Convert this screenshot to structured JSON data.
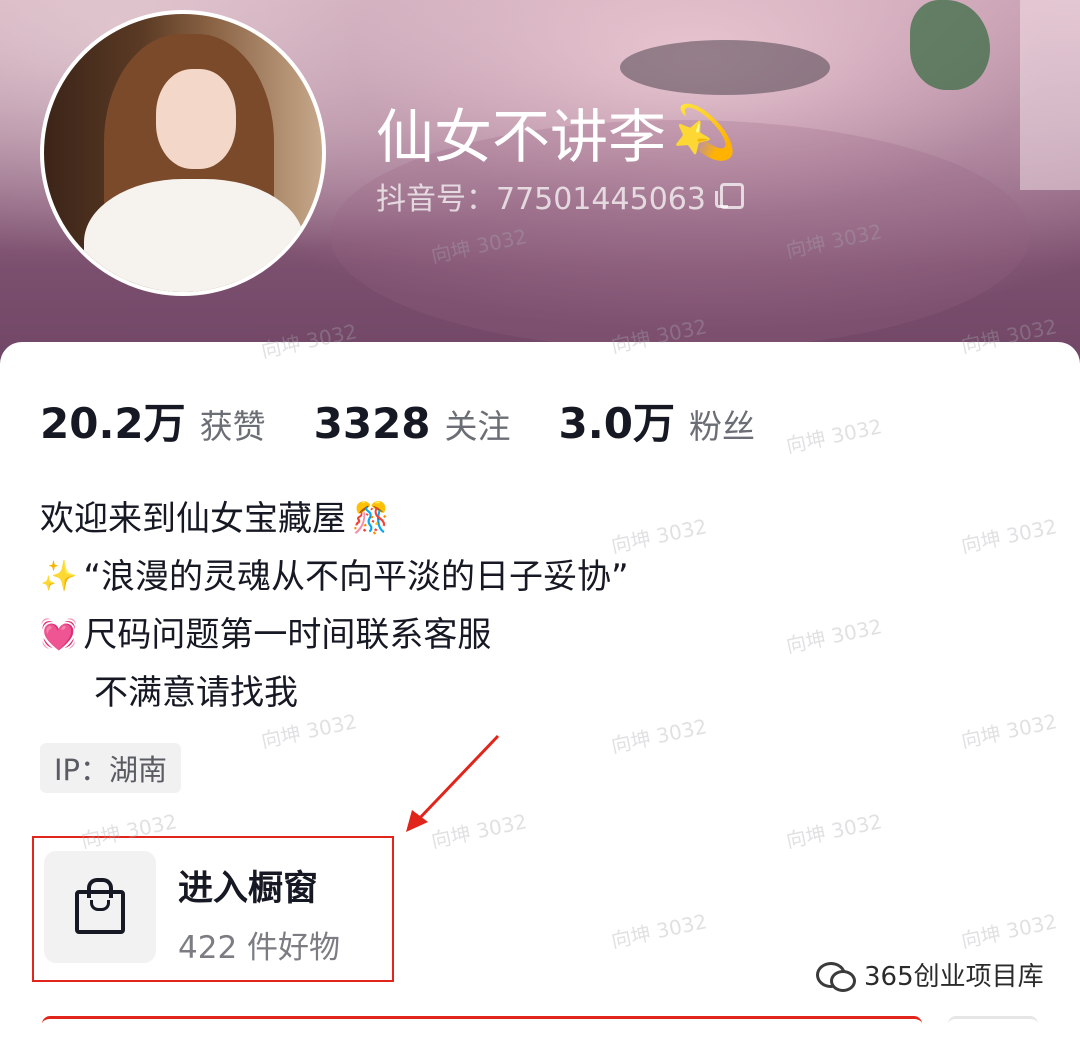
{
  "profile": {
    "nickname": "仙女不讲李",
    "nickname_emoji": "💫",
    "douyin_id": "抖音号：77501445063"
  },
  "stats": [
    {
      "value": "20.2万",
      "label": "获赞"
    },
    {
      "value": "3328",
      "label": "关注"
    },
    {
      "value": "3.0万",
      "label": "粉丝"
    }
  ],
  "bio": {
    "line1": "欢迎来到仙女宝藏屋",
    "line1_emoji": "🎊",
    "line2_emoji": "✨",
    "line2": "“浪漫的灵魂从不向平淡的日子妥协”",
    "line3_emoji": "💓",
    "line3": "尺码问题第一时间联系客服",
    "line4": "不满意请找我"
  },
  "ip_tag": "IP：湖南",
  "shop": {
    "icon": "shopping-bag-icon",
    "title": "进入橱窗",
    "subtitle": "422 件好物"
  },
  "watermark_text": "向坤 3032",
  "source_mark": "365创业项目库",
  "colors": {
    "annotation_red": "#e1251b",
    "text_primary": "#161823",
    "header_purple": "#7b4f6e"
  }
}
